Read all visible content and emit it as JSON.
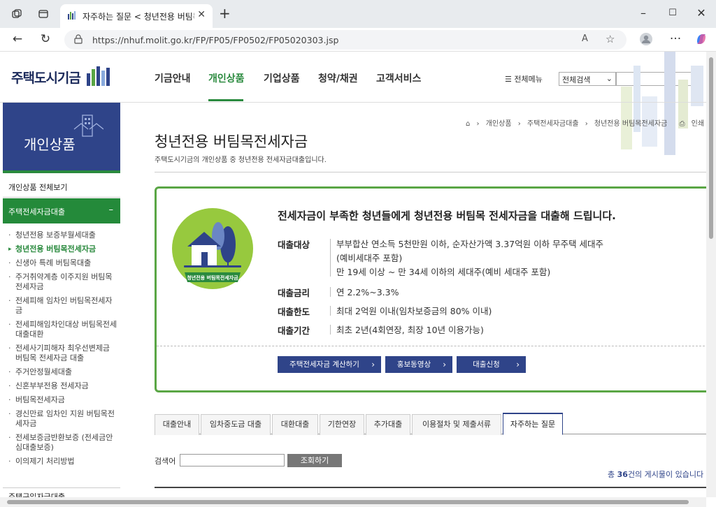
{
  "browser": {
    "tab_title": "자주하는 질문 < 청년전용 버팀목",
    "url": "https://nhuf.molit.go.kr/FP/FP05/FP0502/FP05020303.jsp"
  },
  "header": {
    "logo_text": "주택도시기금",
    "gnb": [
      "기금안내",
      "개인상품",
      "기업상품",
      "청약/채권",
      "고객서비스"
    ],
    "all_menu": "전체메뉴",
    "search_select": "전체검색"
  },
  "side": {
    "banner_title": "개인상품",
    "all_view": "개인상품 전체보기",
    "category": "주택전세자금대출",
    "items": [
      "청년전용 보증부월세대출",
      "청년전용 버팀목전세자금",
      "신생아 특례 버팀목대출",
      "주거취약계층 이주지원 버팀목전세자금",
      "전세피해 임차인 버팀목전세자금",
      "전세피해임차인대상 버팀목전세대출대환",
      "전세사기피해자 최우선변제금 버팀목 전세자금 대출",
      "주거안정월세대출",
      "신혼부부전용 전세자금",
      "버팀목전세자금",
      "경신만료 임차인 지원 버팀목전세자금",
      "전세보증금반환보증 (전세금안심대출보증)",
      "이의제기 처리방법"
    ],
    "category2": "주택구입자금대출"
  },
  "main": {
    "breadcrumb": [
      "개인상품",
      "주택전세자금대출",
      "청년전용 버팀목전세자금"
    ],
    "print_label": "인쇄",
    "title": "청년전용 버팀목전세자금",
    "desc": "주택도시기금의 개인상품 중 청년전용 전세자금대출입니다.",
    "product": {
      "emblem_label": "청년전용 버팀목전세자금",
      "headline": "전세자금이 부족한 청년들에게 청년전용 버팀목 전세자금을 대출해 드립니다.",
      "rows": [
        {
          "label": "대출대상",
          "lines": [
            "부부합산 연소득 5천만원 이하, 순자산가액 3.37억원 이하 무주택 세대주",
            "(예비세대주 포함)",
            "만 19세 이상 ~ 만 34세 이하의 세대주(예비 세대주 포함)"
          ]
        },
        {
          "label": "대출금리",
          "lines": [
            "연 2.2%~3.3%"
          ]
        },
        {
          "label": "대출한도",
          "lines": [
            "최대 2억원 이내(임차보증금의 80% 이내)"
          ]
        },
        {
          "label": "대출기간",
          "lines": [
            "최초 2년(4회연장, 최장 10년 이용가능)"
          ]
        }
      ],
      "buttons": [
        "주택전세자금 계산하기",
        "홍보동영상",
        "대출신청"
      ]
    },
    "tabs": [
      "대출안내",
      "임차중도금 대출",
      "대환대출",
      "기한연장",
      "추가대출",
      "이용절차 및 제출서류",
      "자주하는 질문"
    ],
    "active_tab": "자주하는 질문",
    "search": {
      "label": "검색어",
      "value": "",
      "button": "조회하기"
    },
    "count": {
      "prefix": "총 ",
      "num": "36",
      "suffix": "건의 게시물이 있습니다"
    }
  },
  "colors": {
    "brand_navy": "#2f4489",
    "brand_green": "#2a8a3e",
    "emblem_green": "#97c93e"
  }
}
